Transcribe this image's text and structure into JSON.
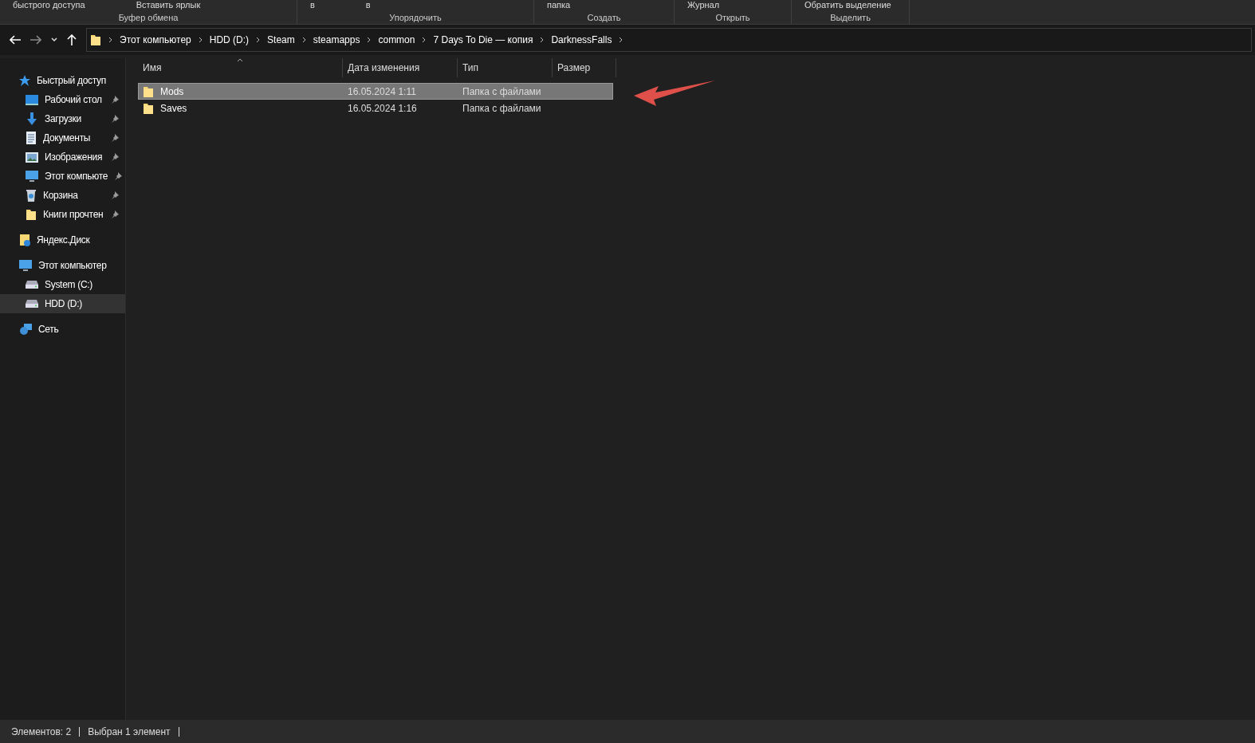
{
  "ribbon": {
    "groups": [
      {
        "label": "Буфер обмена",
        "items": [
          "быстрого доступа",
          "Вставить ярлык"
        ]
      },
      {
        "label": "Упорядочить",
        "items": [
          "в",
          "в"
        ]
      },
      {
        "label": "Создать",
        "items": [
          "папка"
        ]
      },
      {
        "label": "Открыть",
        "items": [
          "Журнал"
        ]
      },
      {
        "label": "Выделить",
        "items": [
          "Обратить выделение"
        ]
      }
    ]
  },
  "address_bar": {
    "path": [
      "Этот компьютер",
      "HDD (D:)",
      "Steam",
      "steamapps",
      "common",
      "7 Days To Die — копия",
      "DarknessFalls"
    ]
  },
  "sidebar": {
    "items": [
      {
        "label": "Быстрый доступ",
        "kind": "star",
        "selected": false,
        "children": [
          {
            "label": "Рабочий стол",
            "kind": "desktop",
            "pinned": true,
            "selected": false
          },
          {
            "label": "Загрузки",
            "kind": "download",
            "pinned": true,
            "selected": false
          },
          {
            "label": "Документы",
            "kind": "document",
            "pinned": true,
            "selected": false
          },
          {
            "label": "Изображения",
            "kind": "image",
            "pinned": true,
            "selected": false
          },
          {
            "label": "Этот компьюте",
            "kind": "pc",
            "pinned": true,
            "selected": false
          },
          {
            "label": "Корзина",
            "kind": "bin",
            "pinned": true,
            "selected": false
          },
          {
            "label": "Книги прочтен",
            "kind": "folder",
            "pinned": true,
            "selected": false
          }
        ]
      },
      {
        "label": "Яндекс.Диск",
        "kind": "cloud",
        "selected": false
      },
      {
        "label": "Этот компьютер",
        "kind": "pc",
        "selected": false,
        "children": [
          {
            "label": "System (C:)",
            "kind": "drive",
            "selected": false
          },
          {
            "label": "HDD (D:)",
            "kind": "drive",
            "selected": true
          }
        ]
      },
      {
        "label": "Сеть",
        "kind": "network",
        "selected": false
      }
    ]
  },
  "file_list": {
    "columns": [
      "Имя",
      "Дата изменения",
      "Тип",
      "Размер"
    ],
    "rows": [
      {
        "name": "Mods",
        "date": "16.05.2024 1:11",
        "type": "Папка с файлами",
        "selected": true
      },
      {
        "name": "Saves",
        "date": "16.05.2024 1:16",
        "type": "Папка с файлами",
        "selected": false
      }
    ]
  },
  "status_bar": [
    "Элементов: 2",
    "Выбран 1 элемент"
  ]
}
